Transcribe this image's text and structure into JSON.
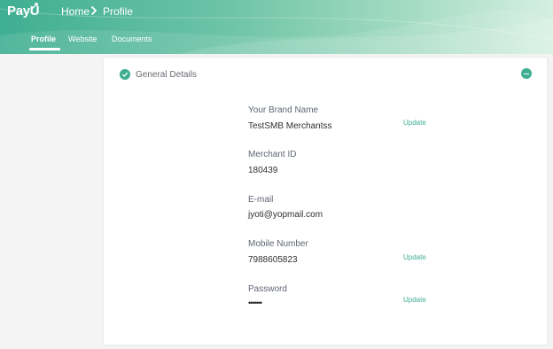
{
  "header": {
    "logo": "PayU",
    "breadcrumb": {
      "home": "Home",
      "current": "Profile"
    },
    "tabs": [
      {
        "label": "Profile",
        "active": true
      },
      {
        "label": "Website",
        "active": false
      },
      {
        "label": "Documents",
        "active": false
      }
    ]
  },
  "section": {
    "title": "General Details"
  },
  "fields": {
    "brand_name": {
      "label": "Your Brand Name",
      "value": "TestSMB Merchantss",
      "action": "Update"
    },
    "merchant_id": {
      "label": "Merchant ID",
      "value": "180439"
    },
    "email": {
      "label": "E-mail",
      "value": "jyoti@yopmail.com"
    },
    "mobile": {
      "label": "Mobile Number",
      "value": "7988605823",
      "action": "Update"
    },
    "password": {
      "label": "Password",
      "value": "•••••••",
      "action": "Update"
    }
  },
  "colors": {
    "accent": "#3fae92",
    "header_start": "#3fae92",
    "header_end": "#d5efe2"
  },
  "icons": {
    "section_status": "check-circle-icon",
    "collapse": "minus-circle-icon",
    "breadcrumb_separator": "chevron-right-icon"
  }
}
